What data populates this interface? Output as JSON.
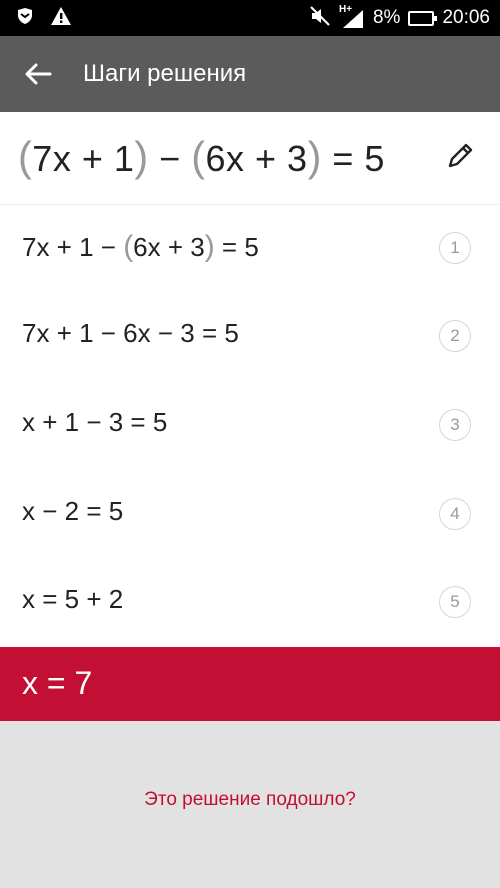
{
  "status_bar": {
    "network_label": "H+",
    "battery_level": "8%",
    "time": "20:06",
    "icons": [
      "shield-icon",
      "warning-icon",
      "mute-icon",
      "signal-icon",
      "battery-charging-icon"
    ]
  },
  "app_bar": {
    "title": "Шаги решения",
    "back_icon": "arrow-left-icon"
  },
  "equation": {
    "p1_open": "(",
    "p1_inner": "7x + 1",
    "p1_close": ")",
    "op": " − ",
    "p2_open": "(",
    "p2_inner": "6x + 3",
    "p2_close": ")",
    "rhs": " = 5",
    "edit_icon": "pencil-icon"
  },
  "steps": [
    {
      "number": "1",
      "pre": "7x + 1 − ",
      "open": "(",
      "inner": "6x + 3",
      "close": ")",
      "post": " = 5"
    },
    {
      "number": "2",
      "text": "7x + 1 − 6x − 3 = 5"
    },
    {
      "number": "3",
      "text": "x + 1 − 3 = 5"
    },
    {
      "number": "4",
      "text": "x − 2 = 5"
    },
    {
      "number": "5",
      "text": "x = 5 + 2"
    }
  ],
  "answer": {
    "text": "x = 7"
  },
  "feedback": {
    "question": "Это решение подошло?"
  },
  "colors": {
    "accent": "#c20f33",
    "app_bar": "#5b5b5b",
    "footer_bg": "#e2e2e2"
  }
}
